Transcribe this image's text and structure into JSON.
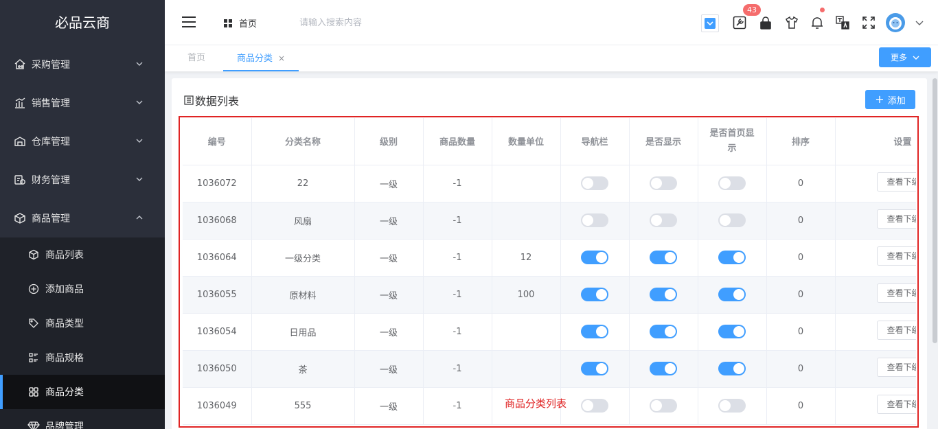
{
  "app": {
    "title": "必品云商"
  },
  "sidebar": {
    "menus": [
      {
        "label": "采购管理",
        "icon": "house-cart-icon",
        "expanded": false
      },
      {
        "label": "销售管理",
        "icon": "bar-chart-icon",
        "expanded": false
      },
      {
        "label": "仓库管理",
        "icon": "warehouse-icon",
        "expanded": false
      },
      {
        "label": "财务管理",
        "icon": "finance-icon",
        "expanded": false
      },
      {
        "label": "商品管理",
        "icon": "box-icon",
        "expanded": true
      }
    ],
    "sub_items": [
      {
        "label": "商品列表",
        "icon": "cube-icon"
      },
      {
        "label": "添加商品",
        "icon": "plus-circle-icon"
      },
      {
        "label": "商品类型",
        "icon": "tag-icon"
      },
      {
        "label": "商品规格",
        "icon": "spec-list-icon"
      },
      {
        "label": "商品分类",
        "icon": "grid-icon",
        "active": true
      },
      {
        "label": "品牌管理",
        "icon": "diamond-icon"
      }
    ]
  },
  "header": {
    "breadcrumb": "首页",
    "search_placeholder": "请输入搜索内容",
    "badge_count": "43",
    "icons": [
      "dropdown-square-icon",
      "tools-icon",
      "lock-icon",
      "shirt-icon",
      "bell-icon",
      "translate-icon",
      "fullscreen-icon",
      "avatar"
    ]
  },
  "tabs": {
    "items": [
      {
        "label": "首页",
        "active": false
      },
      {
        "label": "商品分类",
        "active": true,
        "close": "×"
      }
    ],
    "more_label": "更多"
  },
  "card": {
    "title": "数据列表",
    "add_label": "添加"
  },
  "table": {
    "columns": [
      "编号",
      "分类名称",
      "级别",
      "商品数量",
      "数量单位",
      "导航栏",
      "是否显示",
      "是否首页显示",
      "排序",
      "设置"
    ],
    "view_label": "查看下级",
    "rows": [
      {
        "id": "1036072",
        "name": "22",
        "level": "一级",
        "count": "-1",
        "unit": "",
        "nav": false,
        "show": false,
        "home": false,
        "sort": "0"
      },
      {
        "id": "1036068",
        "name": "风扇",
        "level": "一级",
        "count": "-1",
        "unit": "",
        "nav": false,
        "show": false,
        "home": false,
        "sort": "0"
      },
      {
        "id": "1036064",
        "name": "一级分类",
        "level": "一级",
        "count": "-1",
        "unit": "12",
        "nav": true,
        "show": true,
        "home": true,
        "sort": "0"
      },
      {
        "id": "1036055",
        "name": "原材料",
        "level": "一级",
        "count": "-1",
        "unit": "100",
        "nav": true,
        "show": true,
        "home": true,
        "sort": "0"
      },
      {
        "id": "1036054",
        "name": "日用品",
        "level": "一级",
        "count": "-1",
        "unit": "",
        "nav": true,
        "show": true,
        "home": true,
        "sort": "0"
      },
      {
        "id": "1036050",
        "name": "茶",
        "level": "一级",
        "count": "-1",
        "unit": "",
        "nav": true,
        "show": true,
        "home": true,
        "sort": "0"
      },
      {
        "id": "1036049",
        "name": "555",
        "level": "一级",
        "count": "-1",
        "unit": "",
        "nav": false,
        "show": false,
        "home": false,
        "sort": "0"
      }
    ]
  },
  "annotation": {
    "label": "商品分类列表",
    "color": "#e02424"
  },
  "colors": {
    "accent": "#409eff",
    "sidebar_bg": "#2b2f3a",
    "badge": "#f56c6c"
  }
}
